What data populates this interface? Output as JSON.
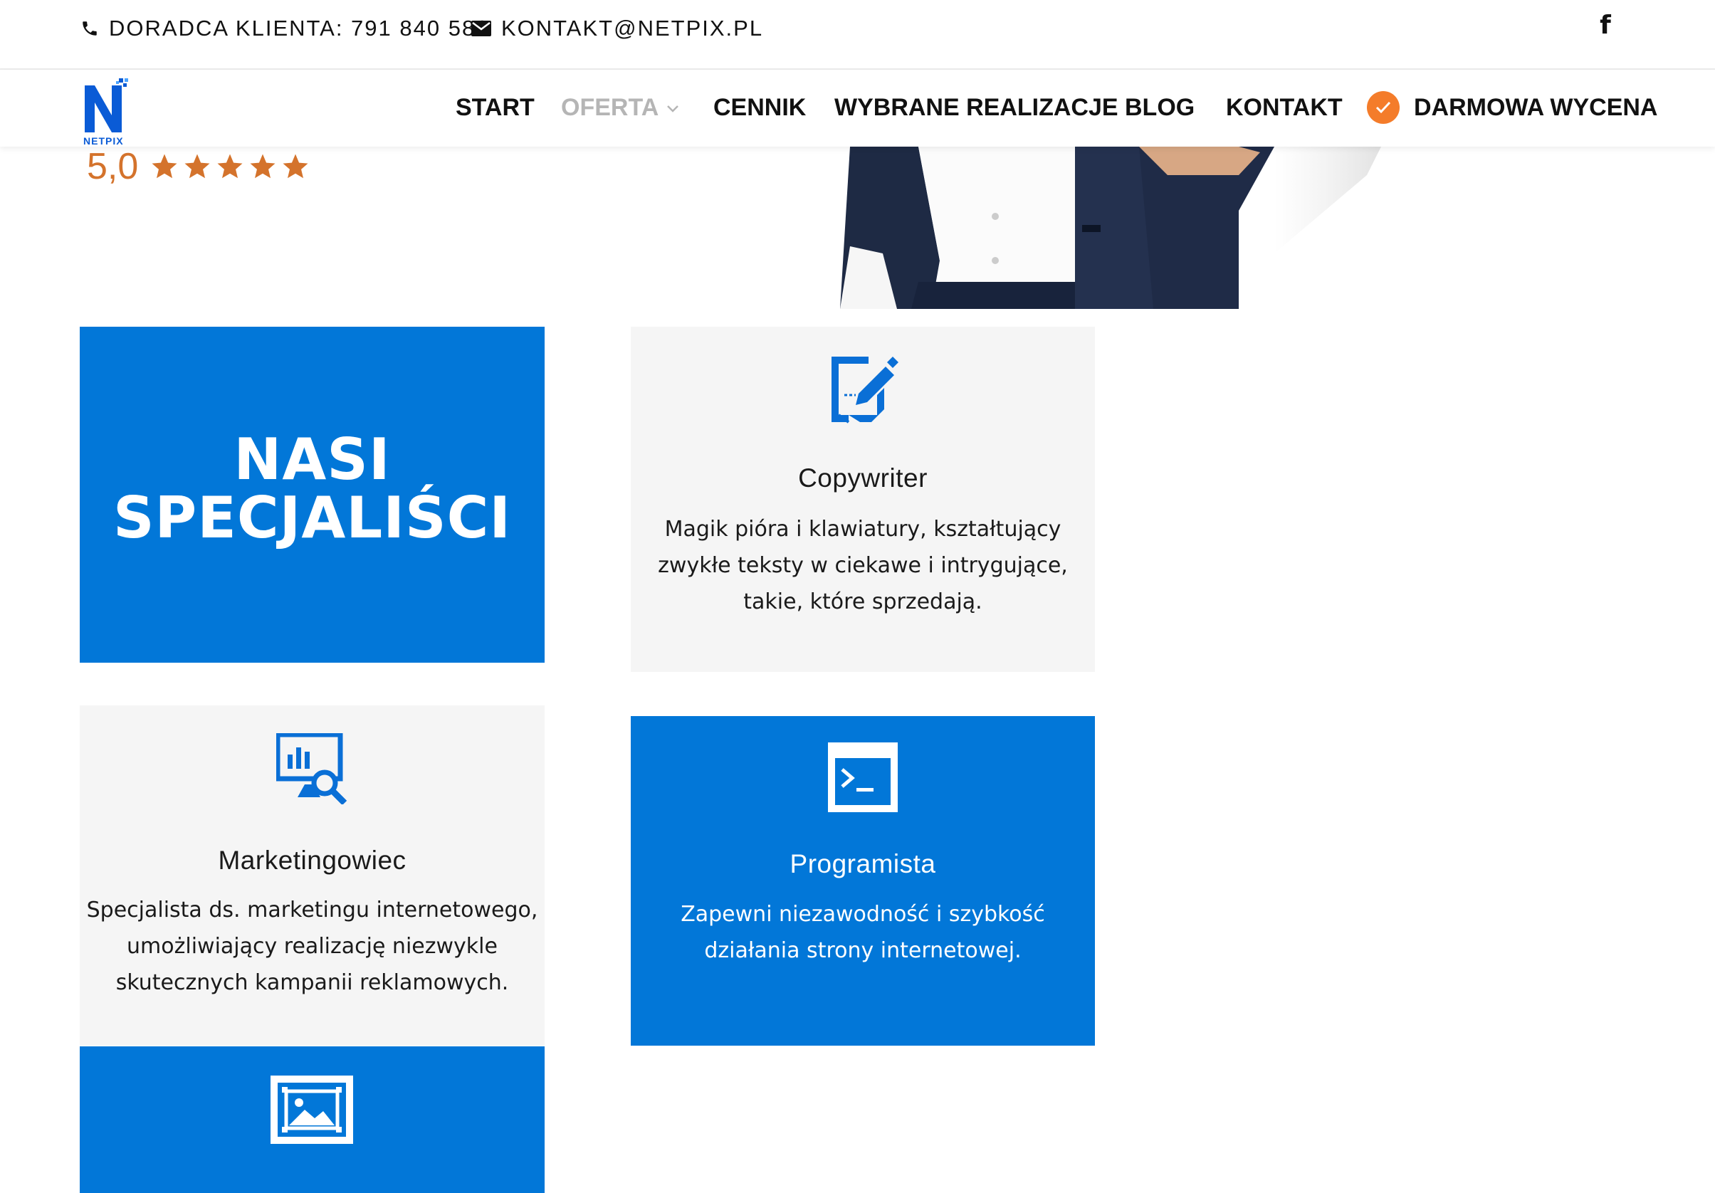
{
  "topbar": {
    "phone_label": "DORADCA KLIENTA: 791 840 586",
    "email_label": "KONTAKT@NETPIX.PL",
    "social_icon": "facebook-icon"
  },
  "brand": {
    "name": "NETPIX",
    "color": "#0a5bd6"
  },
  "nav": {
    "items": [
      {
        "label": "START"
      },
      {
        "label": "OFERTA"
      },
      {
        "label": "CENNIK"
      },
      {
        "label": "WYBRANE REALIZACJE"
      },
      {
        "label": "BLOG"
      },
      {
        "label": "KONTAKT"
      },
      {
        "label": "DARMOWA WYCENA"
      }
    ],
    "cta_color": "#f47c2a"
  },
  "rating": {
    "value": "5,0",
    "stars": 5
  },
  "section": {
    "heading_line1": "NASI",
    "heading_line2": "SPECJALIŚCI"
  },
  "cards": [
    {
      "icon": "document-pen-icon",
      "title": "Copywriter",
      "desc_lines": [
        "Magik pióra i klawiatury, kształtujący",
        "zwykłe teksty w ciekawe i intrygujące,",
        "takie, które sprzedają."
      ]
    },
    {
      "icon": "analytics-monitor-icon",
      "title": "Marketingowiec",
      "desc_lines": [
        "Specjalista ds. marketingu internetowego,",
        "umożliwiający realizację niezwykle",
        "skutecznych kampanii reklamowych."
      ]
    },
    {
      "icon": "terminal-icon",
      "title": "Programista",
      "desc_lines": [
        "Zapewni  niezawodność i szybkość",
        "działania strony internetowej."
      ]
    },
    {
      "icon": "image-frame-icon"
    }
  ],
  "colors": {
    "blue": "#0277d8",
    "gray": "#f5f5f5",
    "star": "#d4732c"
  }
}
